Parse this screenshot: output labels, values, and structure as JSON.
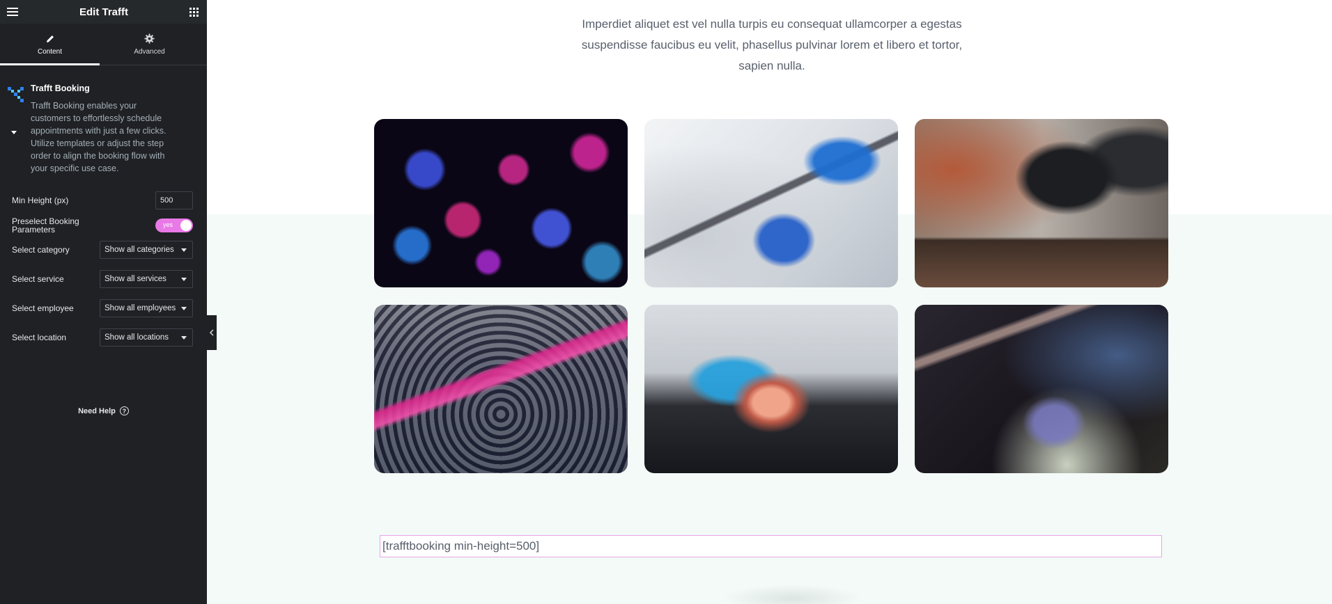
{
  "panel": {
    "title": "Edit Trafft",
    "tabs": [
      {
        "label": "Content",
        "icon": "pencil-icon"
      },
      {
        "label": "Advanced",
        "icon": "gear-icon"
      }
    ]
  },
  "widget": {
    "name": "Trafft Booking",
    "description": "Trafft Booking enables your customers to effortlessly schedule appointments with just a few clicks. Utilize templates or adjust the step order to align the booking flow with your specific use case."
  },
  "controls": {
    "min_height_label": "Min Height (px)",
    "min_height_value": "500",
    "preselect_label": "Preselect Booking Parameters",
    "preselect_value": "yes",
    "category_label": "Select category",
    "category_value": "Show all categories",
    "service_label": "Select service",
    "service_value": "Show all services",
    "employee_label": "Select employee",
    "employee_value": "Show all employees",
    "location_label": "Select location",
    "location_value": "Show all locations"
  },
  "help_label": "Need Help",
  "canvas": {
    "intro_text": "Imperdiet aliquet est vel nulla turpis eu consequat ullamcorper a egestas suspendisse faucibus eu velit, phasellus pulvinar lorem et libero et tortor, sapien nulla.",
    "shortcode": "[trafftbooking min-height=500]"
  },
  "colors": {
    "panel_bg": "#1f2124",
    "toggle_on": "#e879e6",
    "canvas_band": "#f3faf7",
    "shortcode_border": "#e8a5e8"
  }
}
